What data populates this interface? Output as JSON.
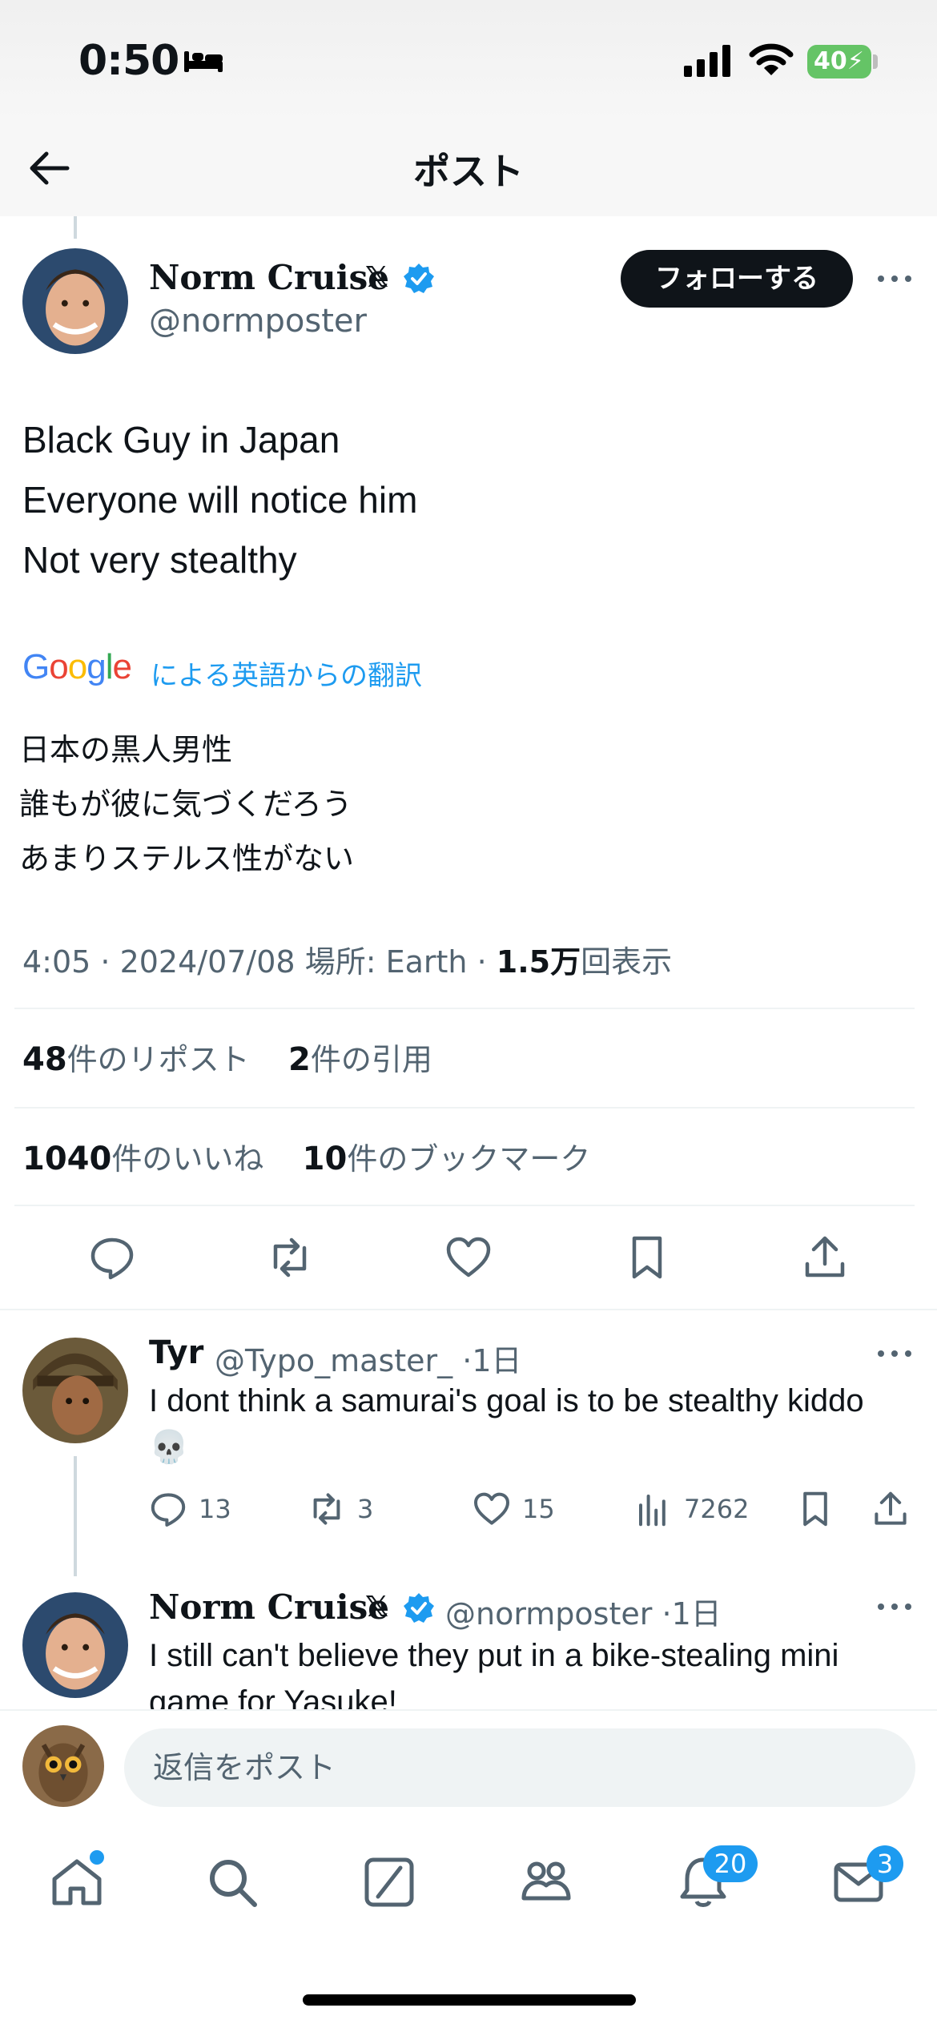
{
  "status_bar": {
    "time": "0:50",
    "battery": "40"
  },
  "header": {
    "title": "ポスト"
  },
  "post": {
    "author": "Norm Cruise",
    "x_badge": "𝕏",
    "handle": "@normposter",
    "follow_label": "フォローする",
    "text_lines": [
      "Black Guy in Japan",
      "Everyone will notice him",
      "Not very stealthy"
    ],
    "google_logo": "Google",
    "translate_label": "による英語からの翻訳",
    "translated_lines": [
      "日本の黒人男性",
      "誰もが彼に気づくだろう",
      "あまりステルス性がない"
    ],
    "timestamp": "4:05 · 2024/07/08",
    "location": "場所: Earth",
    "views_value": "1.5万",
    "views_label": "回表示",
    "reposts_count": "48",
    "reposts_label": "件のリポスト",
    "quotes_count": "2",
    "quotes_label": "件の引用",
    "likes_count": "1040",
    "likes_label": "件のいいね",
    "bookmarks_count": "10",
    "bookmarks_label": "件のブックマーク"
  },
  "replies": [
    {
      "name": "Tyr",
      "handle": "@Typo_master_",
      "time": "1日",
      "text": "I dont think a samurai's goal is to be stealthy kiddo 💀",
      "replies": "13",
      "reposts": "3",
      "likes": "15",
      "views": "7262"
    },
    {
      "name": "Norm Cruise",
      "x_badge": "𝕏",
      "handle": "@normposter",
      "time": "1日",
      "text": "I still can't believe they put in a bike-stealing mini game for Yasuke!"
    }
  ],
  "composer": {
    "placeholder": "返信をポスト"
  },
  "tab_bar": {
    "notifications_badge": "20",
    "messages_badge": "3"
  },
  "colors": {
    "accent": "#1d9bf0",
    "text": "#0f1419",
    "secondary": "#536471",
    "battery": "#65c466"
  }
}
